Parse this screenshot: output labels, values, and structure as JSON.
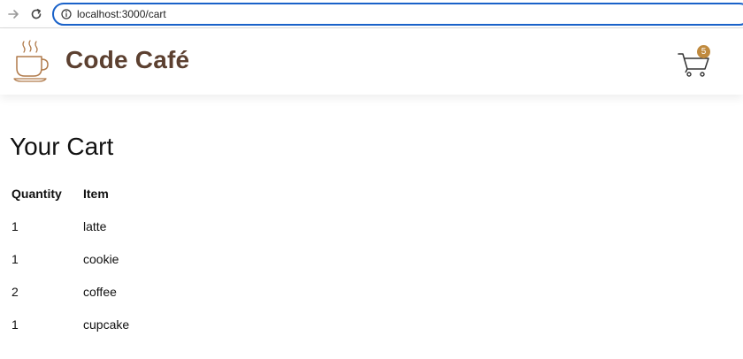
{
  "browser": {
    "url": "localhost:3000/cart"
  },
  "header": {
    "brand": "Code Café",
    "cart_count": "5"
  },
  "main": {
    "title": "Your Cart",
    "table": {
      "headers": [
        "Quantity",
        "Item"
      ],
      "rows": [
        {
          "quantity": "1",
          "item": "latte"
        },
        {
          "quantity": "1",
          "item": "cookie"
        },
        {
          "quantity": "2",
          "item": "coffee"
        },
        {
          "quantity": "1",
          "item": "cupcake"
        }
      ]
    }
  },
  "colors": {
    "brand_text": "#5c4030",
    "logo_stroke": "#b07a4a",
    "badge": "#c08a3e",
    "omnibox_focus": "#1a62c9"
  },
  "icons": [
    "forward-arrow-icon",
    "reload-icon",
    "info-icon",
    "coffee-cup-icon",
    "shopping-cart-icon"
  ]
}
